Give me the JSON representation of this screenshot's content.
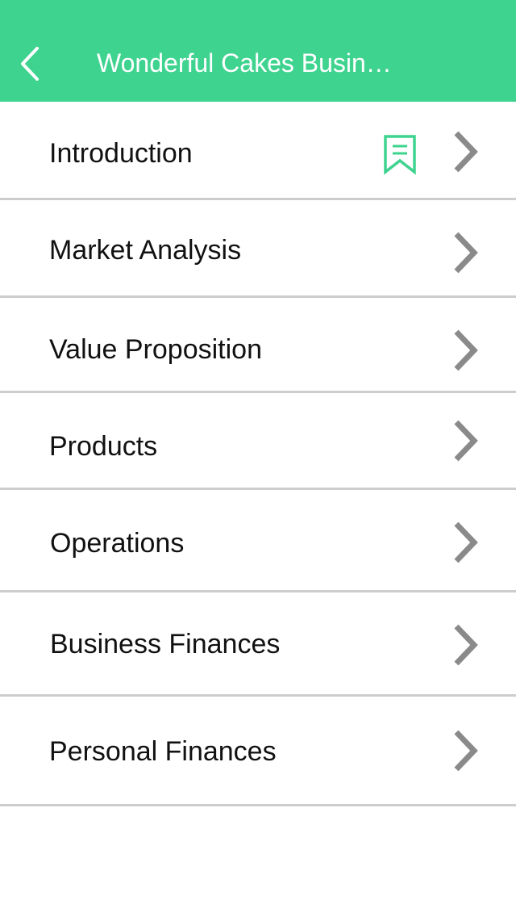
{
  "navbar": {
    "title": "Wonderful Cakes Busin…",
    "background_color": "#3ed38f",
    "back_icon": "chevron-left-icon"
  },
  "list": {
    "items": [
      {
        "label": "Introduction",
        "bookmarked": true
      },
      {
        "label": "Market Analysis",
        "bookmarked": false
      },
      {
        "label": "Value Proposition",
        "bookmarked": false
      },
      {
        "label": "Products",
        "bookmarked": false
      },
      {
        "label": "Operations",
        "bookmarked": false
      },
      {
        "label": "Business Finances",
        "bookmarked": false
      },
      {
        "label": "Personal Finances",
        "bookmarked": false
      }
    ],
    "chevron_icon": "chevron-right-icon",
    "bookmark_icon": "bookmark-icon",
    "accent_color": "#3ed38f",
    "chevron_color": "#8a8a8a",
    "divider_color": "#cdcdcd"
  }
}
